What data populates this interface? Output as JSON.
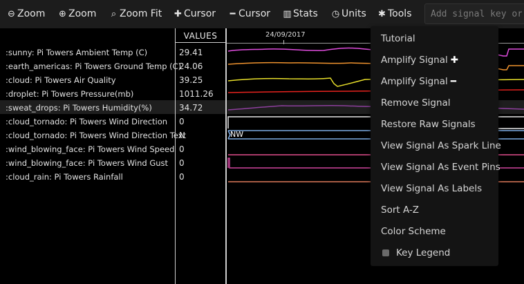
{
  "toolbar": {
    "buttons": [
      {
        "icon": "magnify-minus-icon",
        "glyph": "⊖",
        "label": "Zoom"
      },
      {
        "icon": "magnify-plus-icon",
        "glyph": "⊕",
        "label": "Zoom"
      },
      {
        "icon": "zoom-fit-icon",
        "glyph": "⌕",
        "label": "Zoom Fit"
      },
      {
        "icon": "plus-icon",
        "glyph": "✚",
        "label": "Cursor"
      },
      {
        "icon": "minus-icon",
        "glyph": "━",
        "label": "Cursor"
      },
      {
        "icon": "bar-chart-icon",
        "glyph": "▥",
        "label": "Stats"
      },
      {
        "icon": "clock-icon",
        "glyph": "◷",
        "label": "Units"
      },
      {
        "icon": "gear-icon",
        "glyph": "✱",
        "label": "Tools"
      }
    ],
    "search_placeholder": "Add signal key or"
  },
  "values_header": "VALUES",
  "timeline": {
    "date_label": "24/09/2017",
    "nw_label": "NW"
  },
  "signals": [
    {
      "name": ":sunny: Pi Towers Ambient Temp (C)",
      "value": "29.41",
      "color": "#e24de0"
    },
    {
      "name": ":earth_americas: Pi Towers Ground Temp (C)",
      "value": "24.06",
      "color": "#f0932e"
    },
    {
      "name": ":cloud: Pi Towers Air Quality",
      "value": "39.25",
      "color": "#e8df2a"
    },
    {
      "name": ":droplet: Pi Towers Pressure(mb)",
      "value": "1011.26",
      "color": "#e8231e"
    },
    {
      "name": ":sweat_drops: Pi Towers Humidity(%)",
      "value": "34.72",
      "color": "#8e3f9e"
    },
    {
      "name": ":cloud_tornado: Pi Towers Wind Direction",
      "value": "0",
      "color": "#e8e8e8"
    },
    {
      "name": ":cloud_tornado: Pi Towers Wind Direction Text",
      "value": "N",
      "color": "#7eaee6"
    },
    {
      "name": ":wind_blowing_face: Pi Towers Wind Speed",
      "value": "0",
      "color": "#e24d8e"
    },
    {
      "name": ":wind_blowing_face: Pi Towers Wind Gust",
      "value": "0",
      "color": "#d0459d"
    },
    {
      "name": ":cloud_rain: Pi Towers Rainfall",
      "value": "0",
      "color": "#e07a5a"
    }
  ],
  "tools_menu": {
    "items": [
      {
        "label": "Tutorial",
        "suffix": ""
      },
      {
        "label": "Amplify Signal",
        "suffix": "✚"
      },
      {
        "label": "Amplify Signal",
        "suffix": "━"
      },
      {
        "label": "Remove Signal",
        "suffix": ""
      },
      {
        "label": "Restore Raw Signals",
        "suffix": ""
      },
      {
        "label": "View Signal As Spark Line",
        "suffix": ""
      },
      {
        "label": "View Signal As Event Pins",
        "suffix": ""
      },
      {
        "label": "View Signal As Labels",
        "suffix": ""
      },
      {
        "label": "Sort A-Z",
        "suffix": ""
      },
      {
        "label": "Color Scheme",
        "suffix": ""
      }
    ],
    "key_legend_label": "Key Legend",
    "key_legend_checked": false
  }
}
